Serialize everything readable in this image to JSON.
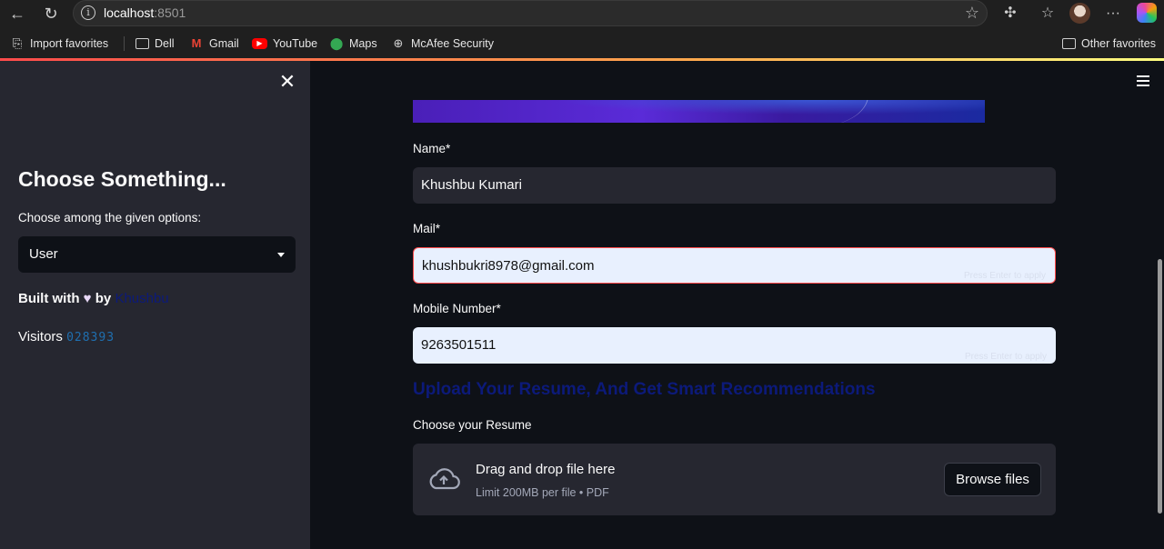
{
  "browser": {
    "url_host": "localhost",
    "url_port": ":8501",
    "bookmarks": {
      "import": "Import favorites",
      "dell": "Dell",
      "gmail": "Gmail",
      "youtube": "YouTube",
      "maps": "Maps",
      "mcafee": "McAfee Security",
      "other": "Other favorites"
    }
  },
  "sidebar": {
    "title": "Choose Something...",
    "select_label": "Choose among the given options:",
    "select_value": "User",
    "built_prefix": "Built with",
    "built_by": "by",
    "author": "Khushbu",
    "visitors_label": "Visitors",
    "visitors_count": "028393"
  },
  "form": {
    "name_label": "Name*",
    "name_value": "Khushbu Kumari",
    "mail_label": "Mail*",
    "mail_value": "khushbukri8978@gmail.com",
    "mail_hint": "Press Enter to apply",
    "mobile_label": "Mobile Number*",
    "mobile_value": "9263501511",
    "mobile_hint": "Press Enter to apply",
    "upload_heading": "Upload Your Resume, And Get Smart Recommendations",
    "resume_label": "Choose your Resume",
    "dropzone_title": "Drag and drop file here",
    "dropzone_limit": "Limit 200MB per file • PDF",
    "browse_button": "Browse files"
  }
}
